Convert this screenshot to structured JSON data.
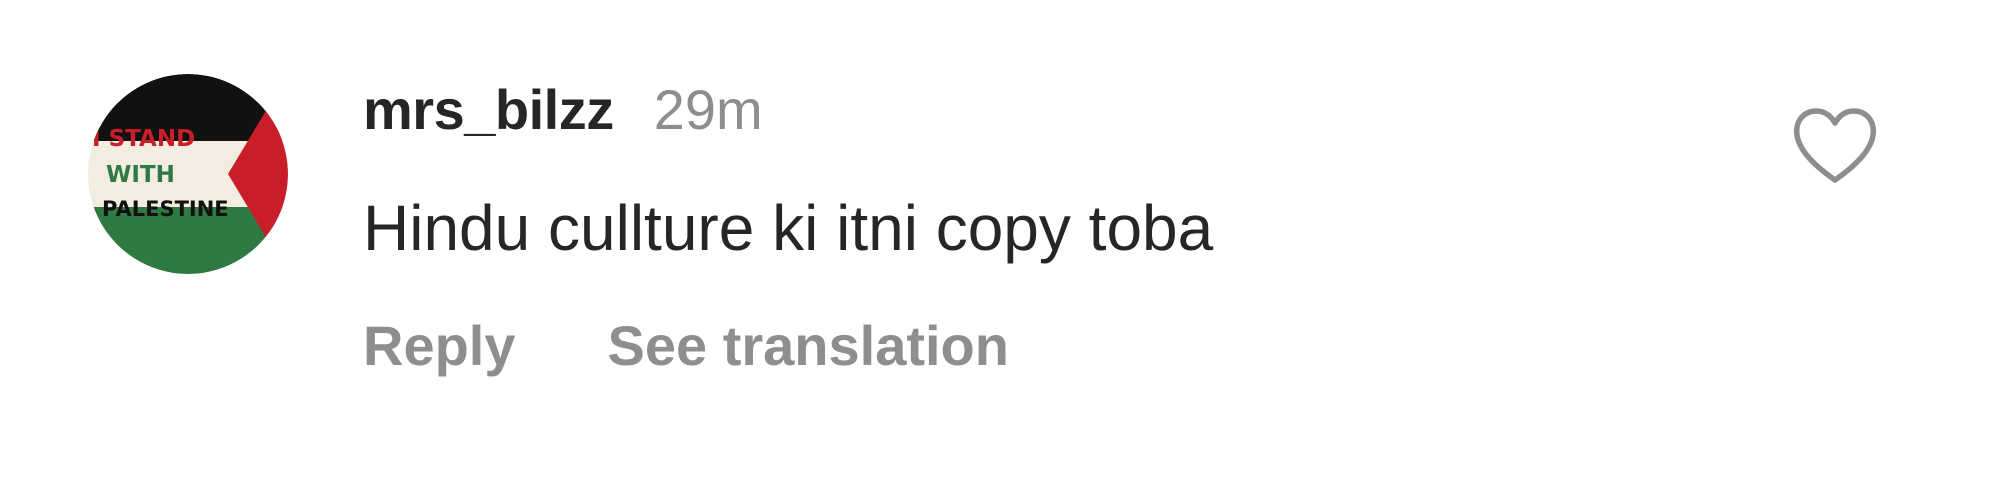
{
  "comment": {
    "avatar": {
      "text_lines": [
        "I STAND",
        "WITH",
        "PALESTINE"
      ],
      "colors": {
        "black": "#111111",
        "white": "#f2ece1",
        "green": "#2f7a42",
        "red": "#c81e2a"
      }
    },
    "username": "mrs_bilzz",
    "timestamp": "29m",
    "text": "Hindu cullture ki itni copy toba",
    "actions": {
      "reply_label": "Reply",
      "see_translation_label": "See translation"
    },
    "like_icon": "heart-outline-icon"
  },
  "colors": {
    "primary_text": "#262626",
    "secondary_text": "#8e8e8e",
    "background": "#ffffff"
  }
}
